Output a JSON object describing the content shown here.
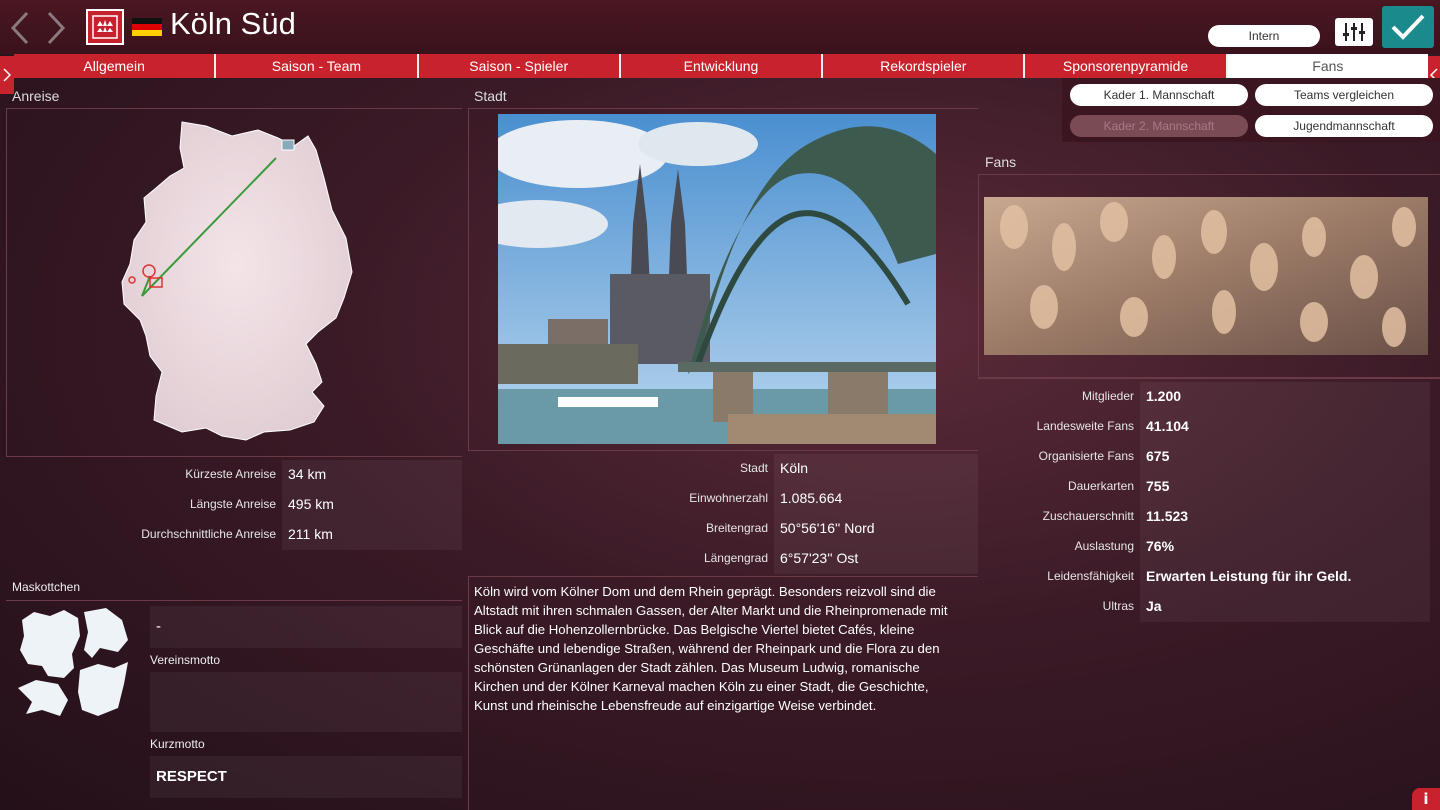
{
  "header": {
    "team_name": "Köln Süd",
    "intern_label": "Intern",
    "accent_color": "#c8232d",
    "confirm_color": "#1a8a8c"
  },
  "tabs": [
    {
      "label": "Allgemein"
    },
    {
      "label": "Saison - Team"
    },
    {
      "label": "Saison - Spieler"
    },
    {
      "label": "Entwicklung"
    },
    {
      "label": "Rekordspieler"
    },
    {
      "label": "Sponsorenpyramide"
    },
    {
      "label": "Fans",
      "active": true
    }
  ],
  "subnav": {
    "kader1": "Kader 1. Mannschaft",
    "teams_vergleichen": "Teams vergleichen",
    "kader2": "Kader 2. Mannschaft",
    "jugend": "Jugendmannschaft"
  },
  "anreise": {
    "title": "Anreise",
    "rows": [
      {
        "label": "Kürzeste Anreise",
        "value": "34 km"
      },
      {
        "label": "Längste Anreise",
        "value": "495 km"
      },
      {
        "label": "Durchschnittliche Anreise",
        "value": "211 km"
      }
    ]
  },
  "maskottchen": {
    "title": "Maskottchen",
    "name_value": "-",
    "vereinsmotto_label": "Vereinsmotto",
    "vereinsmotto_value": "",
    "kurzmotto_label": "Kurzmotto",
    "kurzmotto_value": "RESPECT"
  },
  "stadt": {
    "title": "Stadt",
    "rows": [
      {
        "label": "Stadt",
        "value": "Köln"
      },
      {
        "label": "Einwohnerzahl",
        "value": "1.085.664"
      },
      {
        "label": "Breitengrad",
        "value": "50°56'16'' Nord"
      },
      {
        "label": "Längengrad",
        "value": "6°57'23'' Ost"
      }
    ],
    "description": "Köln wird vom Kölner Dom und dem Rhein geprägt. Besonders reizvoll sind die Altstadt mit ihren schmalen Gassen, der Alter Markt und die Rheinpromenade mit Blick auf die Hohenzollernbrücke. Das Belgische Viertel bietet Cafés, kleine Geschäfte und lebendige Straßen, während der Rheinpark und die Flora zu den schönsten Grünanlagen der Stadt zählen. Das Museum Ludwig, romanische Kirchen und der Kölner Karneval machen Köln zu einer Stadt, die Geschichte, Kunst und rheinische Lebensfreude auf einzigartige Weise verbindet."
  },
  "fans": {
    "title": "Fans",
    "rows": [
      {
        "label": "Mitglieder",
        "value": "1.200"
      },
      {
        "label": "Landesweite Fans",
        "value": "41.104"
      },
      {
        "label": "Organisierte Fans",
        "value": "675"
      },
      {
        "label": "Dauerkarten",
        "value": "755"
      },
      {
        "label": "Zuschauerschnitt",
        "value": "11.523"
      },
      {
        "label": "Auslastung",
        "value": "76%"
      },
      {
        "label": "Leidensfähigkeit",
        "value": "Erwarten Leistung für ihr Geld."
      },
      {
        "label": "Ultras",
        "value": "Ja"
      }
    ]
  },
  "info_label": "i"
}
